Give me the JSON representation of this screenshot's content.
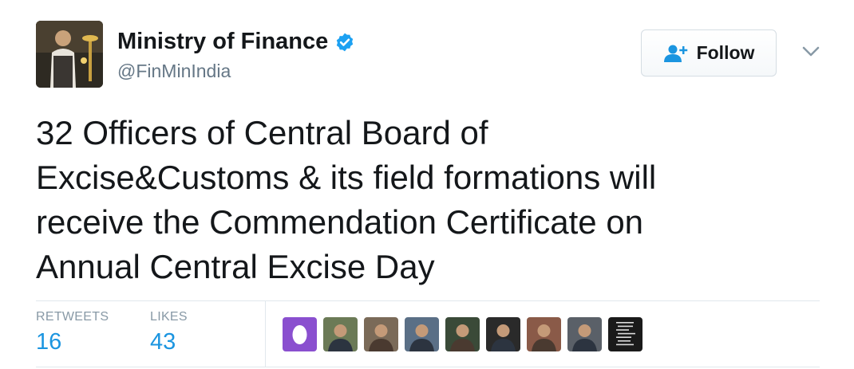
{
  "author": {
    "name": "Ministry of Finance",
    "handle": "@FinMinIndia",
    "verified": true,
    "avatar_icon": "person-lighting-lamp-photo"
  },
  "follow_button": {
    "label": "Follow",
    "icon": "add-user-icon"
  },
  "menu_icon": "chevron-down-icon",
  "tweet": {
    "lines": [
      "32 Officers of Central Board of",
      "Excise&Customs & its field formations will",
      "receive the Commendation Certificate on",
      "Annual Central Excise Day"
    ]
  },
  "stats": {
    "retweets": {
      "label": "RETWEETS",
      "value": "16"
    },
    "likes": {
      "label": "LIKES",
      "value": "43"
    }
  },
  "likers": [
    {
      "kind": "egg",
      "color": "#8a4fcf"
    },
    {
      "kind": "photo",
      "color": "#6b7a56"
    },
    {
      "kind": "photo",
      "color": "#7a6a58"
    },
    {
      "kind": "photo",
      "color": "#5a6f86"
    },
    {
      "kind": "photo",
      "color": "#3a4a38"
    },
    {
      "kind": "photo",
      "color": "#2a2a2a"
    },
    {
      "kind": "photo",
      "color": "#8a5a48"
    },
    {
      "kind": "photo",
      "color": "#5a6068"
    },
    {
      "kind": "quote-image",
      "color": "#1a1a1a"
    }
  ],
  "colors": {
    "accent": "#1b95e0",
    "text": "#14171a",
    "muted": "#657786"
  }
}
